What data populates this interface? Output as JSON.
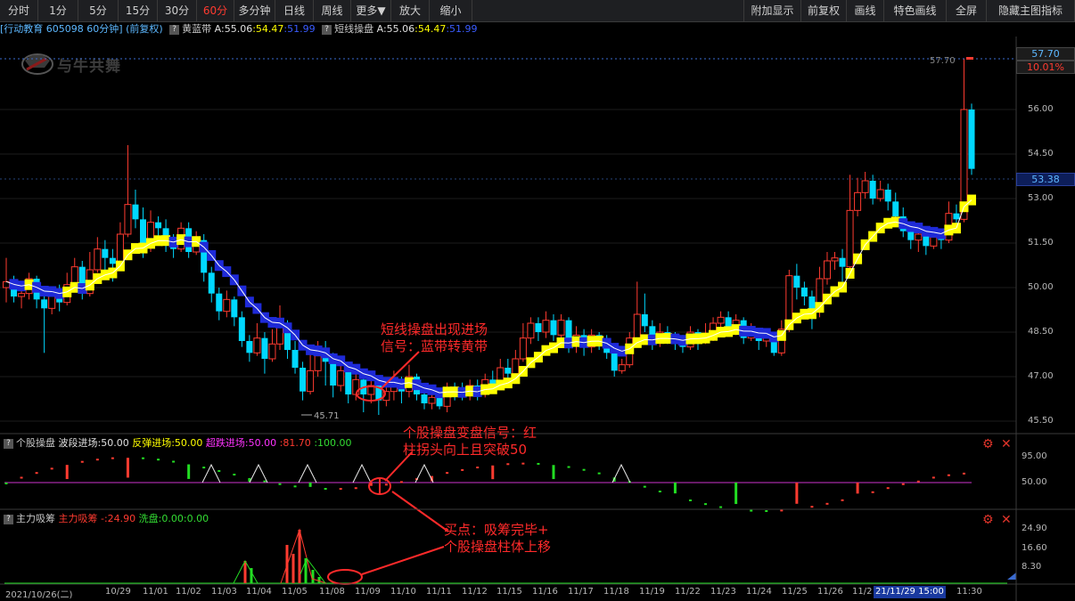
{
  "toolbar": {
    "left": [
      "分时",
      "1分",
      "5分",
      "15分",
      "30分",
      "60分",
      "多分钟",
      "日线",
      "周线",
      "更多▼",
      "放大",
      "缩小"
    ],
    "active": "60分",
    "right": [
      "附加显示",
      "前复权",
      "画线",
      "特色画线",
      "全屏",
      "隐藏主图指标"
    ]
  },
  "info": {
    "stock": "[行动教育 605098 60分钟]",
    "adj": "(前复权)",
    "ind1_name": "黄蓝带",
    "ind1_a": "A:55.06",
    "ind1_b": ":54.47",
    "ind1_c": ":51.99",
    "ind2_name": "短线操盘",
    "ind2_a": "A:55.06",
    "ind2_b": ":54.47",
    "ind2_c": ":51.99",
    "watermark": "与牛共舞"
  },
  "price_axis": {
    "ticks": [
      "56.00",
      "54.50",
      "53.00",
      "51.50",
      "50.00",
      "48.50",
      "47.00",
      "45.50"
    ],
    "high_label": "57.70",
    "high_pct": "10.01%",
    "current": "53.38",
    "max_marker": "57.70",
    "min_marker": "45.71"
  },
  "panel2": {
    "title": "个股操盘",
    "l1": "波段进场",
    "v1": ":50.00",
    "l2": "反弹进场",
    "v2": ":50.00",
    "l3": "超跌进场",
    "v3": ":50.00",
    "v4": ":81.70",
    "v5": ":100.00",
    "ticks": [
      "95.00",
      "50.00"
    ]
  },
  "panel3": {
    "title": "主力吸筹",
    "l1": "主力吸筹 -",
    "v1": ":24.90",
    "l2": "洗盘",
    "v2": ":0.00",
    "v3": ":0.00",
    "ticks": [
      "24.90",
      "16.60",
      "8.30"
    ]
  },
  "xaxis": {
    "labels": [
      "2021/10/26(二)",
      "10/29",
      "11/01",
      "11/02",
      "11/03",
      "11/04",
      "11/05",
      "11/08",
      "11/09",
      "11/10",
      "11/11",
      "11/12",
      "11/15",
      "11/16",
      "11/17",
      "11/18",
      "11/19",
      "11/22",
      "11/23",
      "11/24",
      "11/25",
      "11/26",
      "11/2",
      "11:30"
    ],
    "cursor_date": "21/11/29 15:00"
  },
  "annotations": {
    "a1_line1": "短线操盘出现进场",
    "a1_line2": "信号：蓝带转黄带",
    "a2_line1": "个股操盘变盘信号：红",
    "a2_line2": "柱拐头向上且突破50",
    "a3_line1": "买点：吸筹完毕+",
    "a3_line2": "个股操盘柱体上移"
  },
  "colors": {
    "up": "#ff3b30",
    "down": "#00d8ff",
    "yellow": "#ffff00",
    "blue": "#1e2ad8",
    "annotation": "#ff2a2a",
    "magenta": "#cc33cc"
  },
  "chart_data": {
    "type": "candlestick",
    "ylim": [
      45.5,
      57.7
    ],
    "candles": [
      [
        50.0,
        50.2,
        51.0,
        49.5
      ],
      [
        50.2,
        49.7,
        50.4,
        49.5
      ],
      [
        49.7,
        49.8,
        50.1,
        49.3
      ],
      [
        49.8,
        50.3,
        50.5,
        49.6
      ],
      [
        50.3,
        49.6,
        50.4,
        49.3
      ],
      [
        49.6,
        49.3,
        49.8,
        47.8
      ],
      [
        49.3,
        49.8,
        50.0,
        49.1
      ],
      [
        49.8,
        49.5,
        50.1,
        49.2
      ],
      [
        49.5,
        50.1,
        50.5,
        49.4
      ],
      [
        50.1,
        50.7,
        51.0,
        49.9
      ],
      [
        50.7,
        49.8,
        50.9,
        49.6
      ],
      [
        49.8,
        50.6,
        51.2,
        49.7
      ],
      [
        50.6,
        51.3,
        51.7,
        50.5
      ],
      [
        51.3,
        51.0,
        51.6,
        50.5
      ],
      [
        51.0,
        50.8,
        51.3,
        50.2
      ],
      [
        50.8,
        51.8,
        52.2,
        50.6
      ],
      [
        51.8,
        52.8,
        54.8,
        51.7
      ],
      [
        52.8,
        52.3,
        53.3,
        52.0
      ],
      [
        52.3,
        51.4,
        52.7,
        51.0
      ],
      [
        51.4,
        52.2,
        52.6,
        51.2
      ],
      [
        52.2,
        52.0,
        52.4,
        51.7
      ],
      [
        52.0,
        51.6,
        52.3,
        51.2
      ],
      [
        51.6,
        51.3,
        51.8,
        51.0
      ],
      [
        51.3,
        52.0,
        52.2,
        51.2
      ],
      [
        52.0,
        51.2,
        52.2,
        51.0
      ],
      [
        51.2,
        51.6,
        51.9,
        51.1
      ],
      [
        51.6,
        50.5,
        51.8,
        50.2
      ],
      [
        50.5,
        49.8,
        50.7,
        49.5
      ],
      [
        49.8,
        49.2,
        50.0,
        48.9
      ],
      [
        49.2,
        49.6,
        49.9,
        49.0
      ],
      [
        49.6,
        49.0,
        49.7,
        48.7
      ],
      [
        49.0,
        48.2,
        49.2,
        48.0
      ],
      [
        48.2,
        47.8,
        48.4,
        47.5
      ],
      [
        47.8,
        48.3,
        48.8,
        47.7
      ],
      [
        48.3,
        47.6,
        48.5,
        47.1
      ],
      [
        47.6,
        48.1,
        48.6,
        47.5
      ],
      [
        48.1,
        48.7,
        49.4,
        47.9
      ],
      [
        48.7,
        47.9,
        48.9,
        47.6
      ],
      [
        47.9,
        47.3,
        48.2,
        47.1
      ],
      [
        47.3,
        46.5,
        47.5,
        46.2
      ],
      [
        46.5,
        47.2,
        47.8,
        46.4
      ],
      [
        47.2,
        47.7,
        48.2,
        47.0
      ],
      [
        47.7,
        47.5,
        48.2,
        46.7
      ],
      [
        47.5,
        46.7,
        47.8,
        46.3
      ],
      [
        46.7,
        47.2,
        47.5,
        46.5
      ],
      [
        47.2,
        46.4,
        47.3,
        46.1
      ],
      [
        46.4,
        46.9,
        47.3,
        46.2
      ],
      [
        46.9,
        46.4,
        47.1,
        45.8
      ],
      [
        46.4,
        46.7,
        47.0,
        46.1
      ],
      [
        46.7,
        46.2,
        46.9,
        45.71
      ],
      [
        46.2,
        46.5,
        46.8,
        46.0
      ],
      [
        46.5,
        46.8,
        47.2,
        46.2
      ],
      [
        46.8,
        46.5,
        47.0,
        46.1
      ],
      [
        46.5,
        47.0,
        47.4,
        46.3
      ],
      [
        47.0,
        46.4,
        47.1,
        46.2
      ],
      [
        46.4,
        46.1,
        46.6,
        45.9
      ],
      [
        46.1,
        46.3,
        46.5,
        45.9
      ],
      [
        46.3,
        46.0,
        46.5,
        45.9
      ],
      [
        46.0,
        46.6,
        46.8,
        45.8
      ],
      [
        46.6,
        46.5,
        46.8,
        46.2
      ],
      [
        46.5,
        46.4,
        46.8,
        46.2
      ],
      [
        46.4,
        46.7,
        46.9,
        46.2
      ],
      [
        46.7,
        46.4,
        46.9,
        46.2
      ],
      [
        46.4,
        46.9,
        47.1,
        46.3
      ],
      [
        46.9,
        46.7,
        47.2,
        46.5
      ],
      [
        46.7,
        47.3,
        47.6,
        46.6
      ],
      [
        47.3,
        47.1,
        47.6,
        46.8
      ],
      [
        47.1,
        47.6,
        47.9,
        46.9
      ],
      [
        47.6,
        48.3,
        48.8,
        47.5
      ],
      [
        48.3,
        48.8,
        49.0,
        48.1
      ],
      [
        48.8,
        48.5,
        49.0,
        48.2
      ],
      [
        48.5,
        48.9,
        49.2,
        48.3
      ],
      [
        48.9,
        48.4,
        49.1,
        48.2
      ],
      [
        48.4,
        48.9,
        49.1,
        48.2
      ],
      [
        48.9,
        48.1,
        49.0,
        47.8
      ],
      [
        48.1,
        48.4,
        48.7,
        47.8
      ],
      [
        48.4,
        48.0,
        48.6,
        47.7
      ],
      [
        48.0,
        48.4,
        48.6,
        47.8
      ],
      [
        48.4,
        48.2,
        48.5,
        47.9
      ],
      [
        48.2,
        47.8,
        48.4,
        47.6
      ],
      [
        47.8,
        47.2,
        48.0,
        47.0
      ],
      [
        47.2,
        47.4,
        47.6,
        47.1
      ],
      [
        47.4,
        48.3,
        48.5,
        47.3
      ],
      [
        48.3,
        49.1,
        50.2,
        48.2
      ],
      [
        49.1,
        48.7,
        49.8,
        48.5
      ],
      [
        48.7,
        48.2,
        48.9,
        47.9
      ],
      [
        48.2,
        48.5,
        48.8,
        48.0
      ],
      [
        48.5,
        48.3,
        48.7,
        48.1
      ],
      [
        48.3,
        48.2,
        48.5,
        47.9
      ],
      [
        48.2,
        48.0,
        48.4,
        47.8
      ],
      [
        48.0,
        48.5,
        48.7,
        47.9
      ],
      [
        48.5,
        48.3,
        48.6,
        47.9
      ],
      [
        48.3,
        48.4,
        48.8,
        48.1
      ],
      [
        48.4,
        48.8,
        49.0,
        48.2
      ],
      [
        48.8,
        49.0,
        49.2,
        48.5
      ],
      [
        49.0,
        48.6,
        49.2,
        48.4
      ],
      [
        48.6,
        48.9,
        49.1,
        48.4
      ],
      [
        48.9,
        48.3,
        49.0,
        48.1
      ],
      [
        48.3,
        48.5,
        48.8,
        48.2
      ],
      [
        48.5,
        48.2,
        48.6,
        47.9
      ],
      [
        48.2,
        48.4,
        48.6,
        48.0
      ],
      [
        48.4,
        47.8,
        48.5,
        47.7
      ],
      [
        47.8,
        48.6,
        48.9,
        47.7
      ],
      [
        48.6,
        50.4,
        50.6,
        48.5
      ],
      [
        50.4,
        50.0,
        50.8,
        49.6
      ],
      [
        50.0,
        49.7,
        50.2,
        49.4
      ],
      [
        49.7,
        49.2,
        49.9,
        48.6
      ],
      [
        49.2,
        50.3,
        50.7,
        49.0
      ],
      [
        50.3,
        50.9,
        51.2,
        50.1
      ],
      [
        50.9,
        51.0,
        51.2,
        50.6
      ],
      [
        51.0,
        50.7,
        51.3,
        50.2
      ],
      [
        50.7,
        52.6,
        53.8,
        50.5
      ],
      [
        52.6,
        53.2,
        53.7,
        52.4
      ],
      [
        53.2,
        53.6,
        53.9,
        53.0
      ],
      [
        53.6,
        53.0,
        53.8,
        52.8
      ],
      [
        53.0,
        53.3,
        53.6,
        52.9
      ],
      [
        53.3,
        52.9,
        53.5,
        52.6
      ],
      [
        52.9,
        52.4,
        53.2,
        52.1
      ],
      [
        52.4,
        51.9,
        52.7,
        51.7
      ],
      [
        51.9,
        51.6,
        52.1,
        51.3
      ],
      [
        51.6,
        51.8,
        52.0,
        51.2
      ],
      [
        51.8,
        51.4,
        52.0,
        51.1
      ],
      [
        51.4,
        51.7,
        52.0,
        51.3
      ],
      [
        51.7,
        51.6,
        51.9,
        51.3
      ],
      [
        51.6,
        52.5,
        52.9,
        51.5
      ],
      [
        52.5,
        52.3,
        52.8,
        52.0
      ],
      [
        52.3,
        56.0,
        57.7,
        52.2
      ],
      [
        56.0,
        54.0,
        56.2,
        53.8
      ]
    ]
  }
}
